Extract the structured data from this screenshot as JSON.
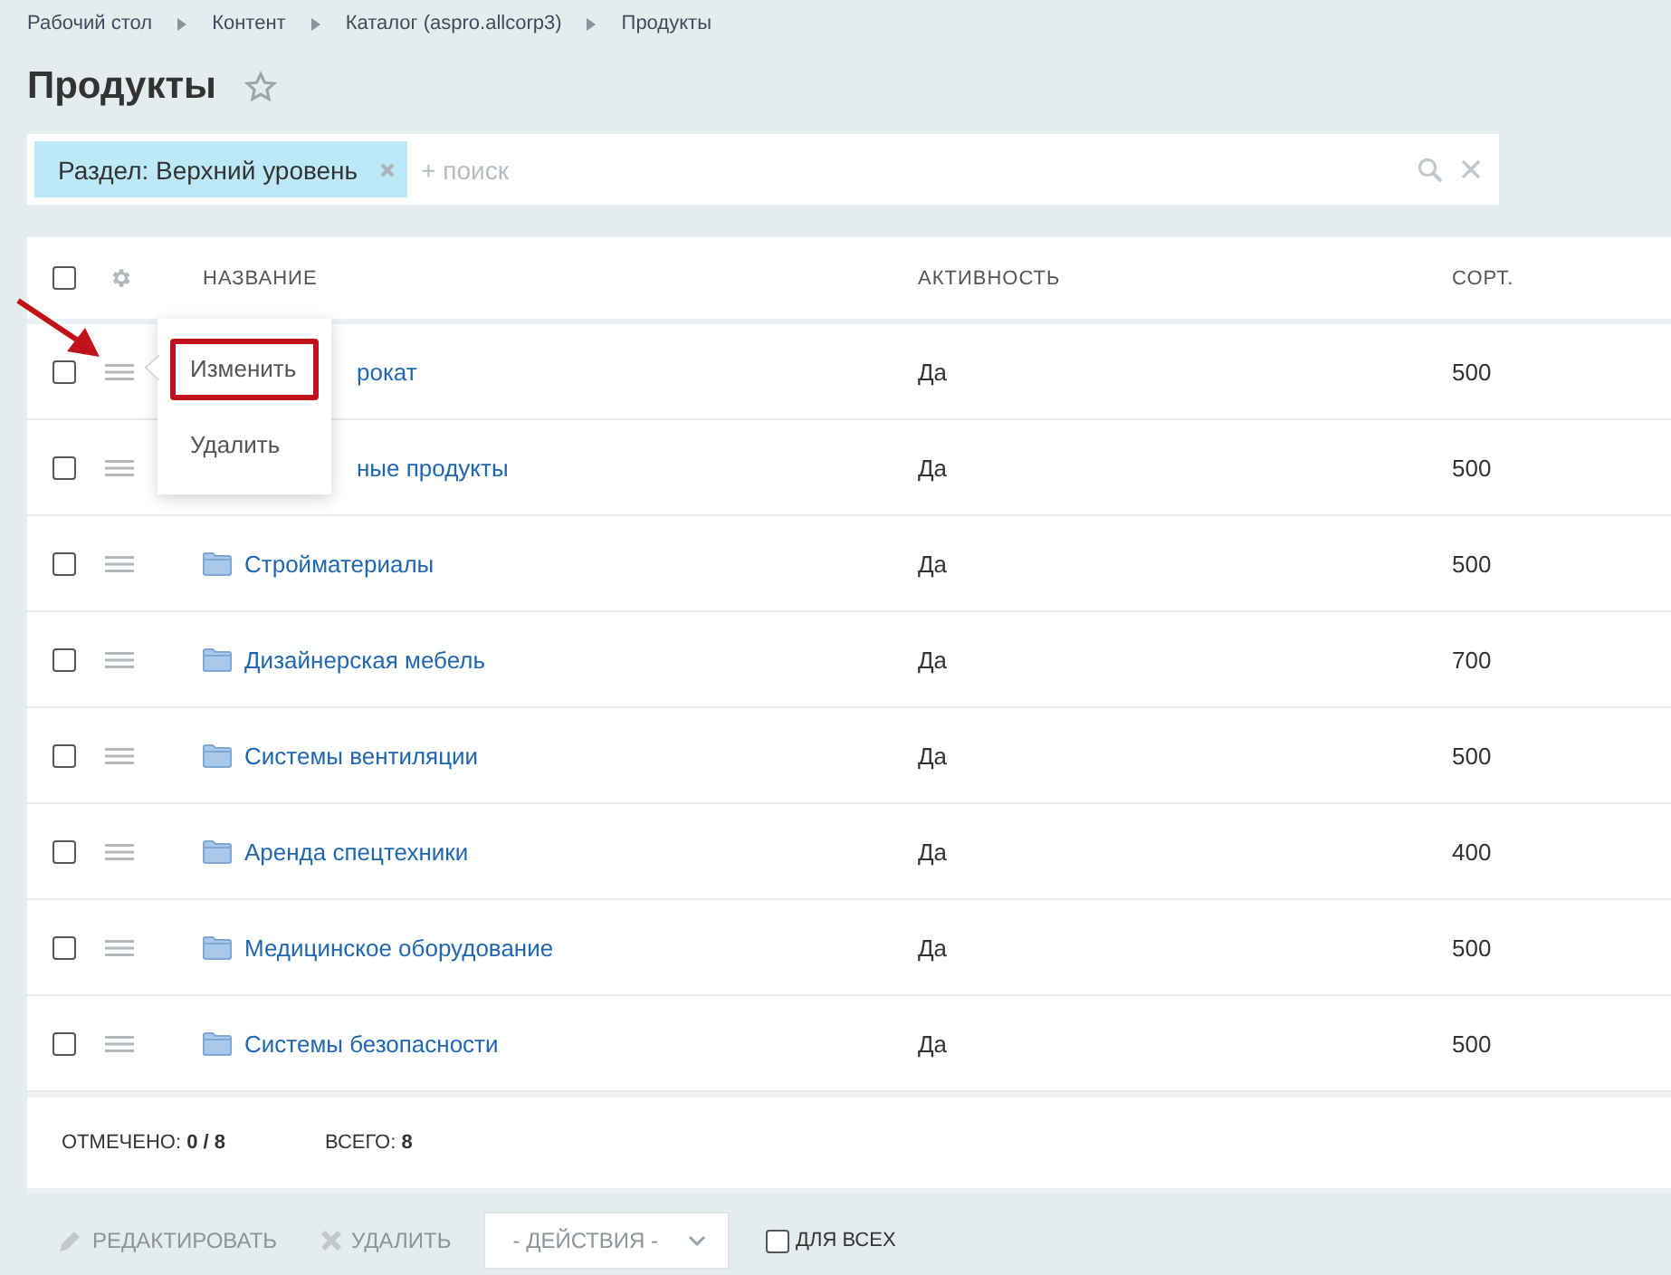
{
  "breadcrumbs": [
    "Рабочий стол",
    "Контент",
    "Каталог (aspro.allcorp3)",
    "Продукты"
  ],
  "title": "Продукты",
  "filter": {
    "tag": "Раздел: Верхний уровень",
    "placeholder": "+ поиск"
  },
  "table": {
    "select_all": {
      "checked": false
    },
    "columns": [
      "НАЗВАНИЕ",
      "АКТИВНОСТЬ",
      "СОРТ."
    ],
    "rows": [
      {
        "kind": "covered",
        "checked": false,
        "name": "рокат",
        "active": "Да",
        "sort": "500"
      },
      {
        "kind": "covered",
        "checked": false,
        "name": "ные продукты",
        "active": "Да",
        "sort": "500"
      },
      {
        "kind": "folder",
        "checked": false,
        "name": "Стройматериалы",
        "active": "Да",
        "sort": "500"
      },
      {
        "kind": "folder",
        "checked": false,
        "name": "Дизайнерская мебель",
        "active": "Да",
        "sort": "700"
      },
      {
        "kind": "folder",
        "checked": false,
        "name": "Системы вентиляции",
        "active": "Да",
        "sort": "500"
      },
      {
        "kind": "folder",
        "checked": false,
        "name": "Аренда спецтехники",
        "active": "Да",
        "sort": "400"
      },
      {
        "kind": "folder",
        "checked": false,
        "name": "Медицинское оборудование",
        "active": "Да",
        "sort": "500"
      },
      {
        "kind": "folder",
        "checked": false,
        "name": "Системы безопасности",
        "active": "Да",
        "sort": "500"
      }
    ],
    "context_menu": [
      {
        "label": "Изменить",
        "selected": true
      },
      {
        "label": "Удалить",
        "selected": false
      }
    ],
    "footer": {
      "checked_label": "ОТМЕЧЕНО:",
      "checked_value": "0 / 8",
      "total_label": "ВСЕГО:",
      "total_value": "8"
    }
  },
  "actions": {
    "edit": "РЕДАКТИРОВАТЬ",
    "delete": "УДАЛИТЬ",
    "select": "- ДЕЙСТВИЯ -",
    "for_all": {
      "label": "ДЛЯ ВСЕХ",
      "checked": false
    }
  }
}
